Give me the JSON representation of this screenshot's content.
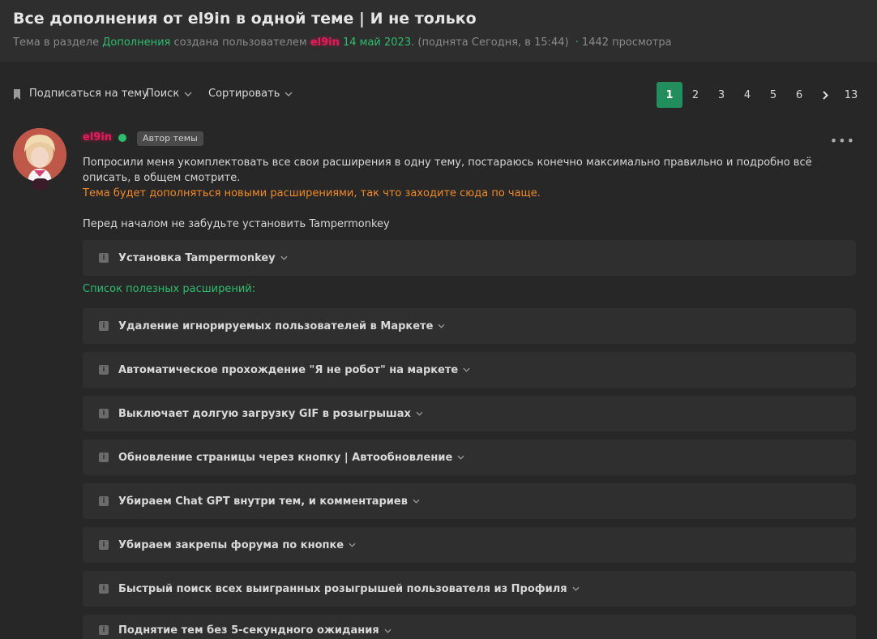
{
  "thread": {
    "title": "Все дополнения от el9in в одной теме | И не только",
    "meta_prefix": "Тема в разделе",
    "section": "Дополнения",
    "meta_created": "создана пользователем",
    "author": "el9in",
    "date": "14 май 2023",
    "raised": ". (поднята Сегодня, в 15:44)",
    "views": "1442 просмотра"
  },
  "toolbar": {
    "subscribe": "Подписаться на тему",
    "search": "Поиск",
    "sort": "Сортировать",
    "pages": [
      "1",
      "2",
      "3",
      "4",
      "5",
      "6"
    ],
    "last_page": "13",
    "active_page": "1"
  },
  "post": {
    "author": "el9in",
    "badge": "Автор темы",
    "more": "•••",
    "p1": "Попросили меня укомплектовать все свои расширения в одну тему, постараюсь конечно максимально правильно и подробно всё описать, в общем смотрите.",
    "p2": "Тема будет дополняться новыми расширениями, так что заходите сюда по чаще.",
    "p3": "Перед началом не забудьте установить Tampermonkey",
    "install_spoiler": "Установка Tampermonkey",
    "list_title": "Список полезных расширений:",
    "spoilers": [
      "Удаление игнорируемых пользователей в Маркете",
      "Автоматическое прохождение \"Я не робот\" на маркете",
      "Выключает долгую загрузку GIF в розыгрышах",
      "Обновление страницы через кнопку | Автообновление",
      "Убираем Chat GPT внутри тем, и комментариев",
      "Убираем закрепы форума по кнопке",
      "Быстрый поиск всех выигранных розыгрышей пользователя из Профиля",
      "Поднятие тем без 5-секундного ожидания"
    ]
  },
  "colors": {
    "accent": "#228e5d",
    "green_text": "#2dbd6e",
    "nick": "#e8195a",
    "orange": "#f08a24"
  }
}
